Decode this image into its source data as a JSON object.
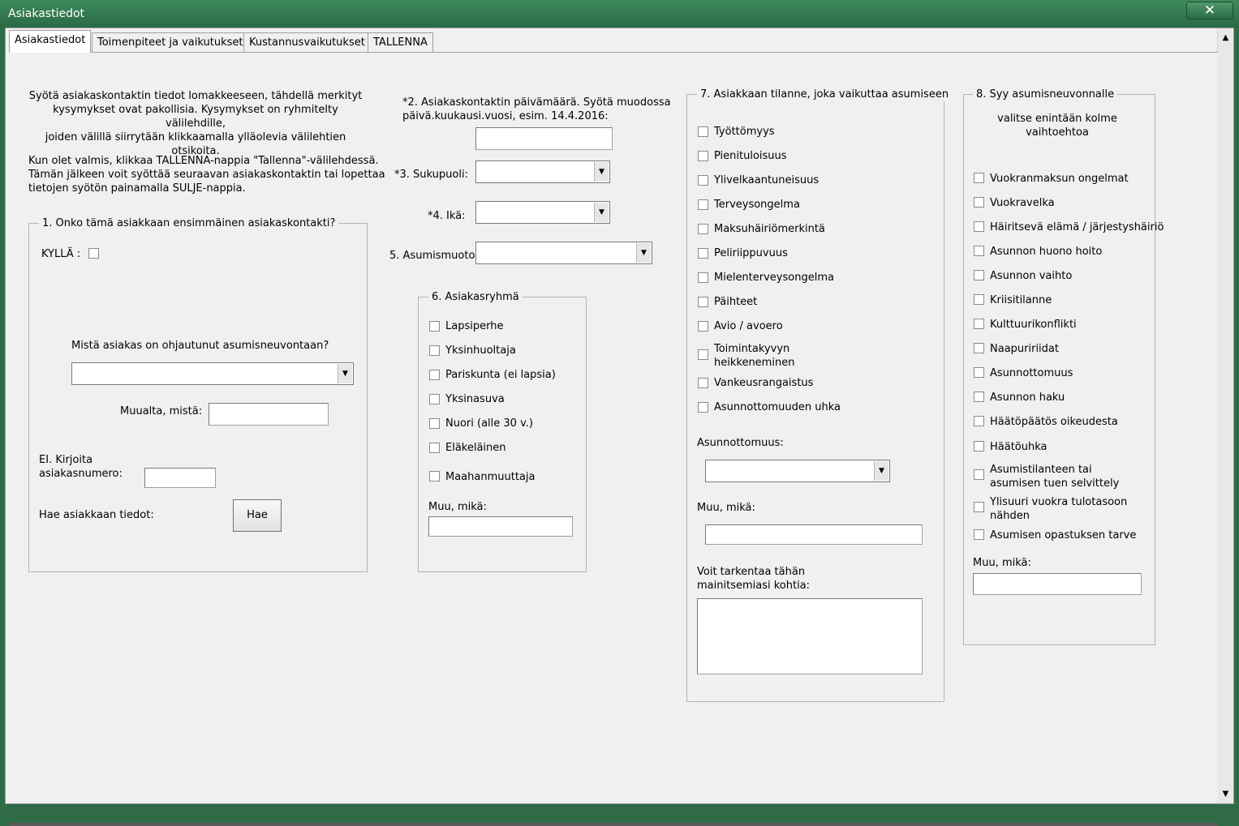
{
  "window": {
    "title": "Asiakastiedot",
    "close_label": "✕"
  },
  "tabs": [
    "Asiakastiedot",
    "Toimenpiteet ja vaikutukset",
    "Kustannusvaikutukset",
    "TALLENNA"
  ],
  "intro": {
    "line1": "Syötä asiakaskontaktin tiedot lomakkeeseen, tähdellä merkityt",
    "line2": "kysymykset ovat pakollisia. Kysymykset on ryhmitelty välilehdille,",
    "line3": "joiden välillä siirrytään klikkaamalla ylläolevia välilehtien otsikoita.",
    "line4": "Kun olet valmis, klikkaa TALLENNA-nappia \"Tallenna\"-välilehdessä.",
    "line5": "Tämän jälkeen voit syöttää seuraavan asiakaskontaktin tai lopettaa",
    "line6": "tietojen syötön painamalla SULJE-nappia."
  },
  "q1": {
    "legend": "1. Onko tämä asiakkaan ensimmäinen asiakaskontakti?",
    "yes_label": "KYLLÄ :",
    "referral_label": "Mistä asiakas on ohjautunut asumisneuvontaan?",
    "other_label": "Muualta, mistä:",
    "no_label_line1": "EI. Kirjoita",
    "no_label_line2": "asiakasnumero:",
    "fetch_label": "Hae asiakkaan tiedot:",
    "fetch_button": "Hae"
  },
  "q2": {
    "line1": "*2. Asiakaskontaktin päivämäärä. Syötä muodossa",
    "line2": "päivä.kuukausi.vuosi, esim. 14.4.2016:"
  },
  "q3": {
    "label": "*3. Sukupuoli:"
  },
  "q4": {
    "label": "*4. Ikä:"
  },
  "q5": {
    "label": "5. Asumismuoto:"
  },
  "q6": {
    "legend": "6. Asiakasryhmä",
    "options": [
      "Lapsiperhe",
      "Yksinhuoltaja",
      "Pariskunta (ei lapsia)",
      "Yksinasuva",
      "Nuori (alle 30 v.)",
      "Eläkeläinen",
      "Maahanmuuttaja"
    ],
    "other_label": "Muu, mikä:"
  },
  "q7": {
    "legend": "7. Asiakkaan tilanne, joka vaikuttaa asumiseen",
    "options": [
      "Työttömyys",
      "Pienituloisuus",
      "Ylivelkaantuneisuus",
      "Terveysongelma",
      "Maksuhäiriömerkintä",
      "Peliriippuvuus",
      "Mielenterveysongelma",
      "Päihteet",
      "Avio / avoero",
      "Toimintakyvyn",
      "heikkeneminen",
      "Vankeusrangaistus",
      "Asunnottomuuden uhka"
    ],
    "homeless_label": "Asunnottomuus:",
    "other_label": "Muu, mikä:",
    "specify_line1": "Voit tarkentaa tähän",
    "specify_line2": "mainitsemiasi kohtia:"
  },
  "q8": {
    "legend": "8. Syy asumisneuvonnalle",
    "hint_line1": "valitse enintään kolme",
    "hint_line2": "vaihtoehtoa",
    "options": [
      "Vuokranmaksun ongelmat",
      "Vuokravelka",
      "Häiritsevä elämä / järjestyshäiriö",
      "Asunnon huono hoito",
      "Asunnon vaihto",
      "Kriisitilanne",
      "Kulttuurikonflikti",
      "Naapuririidat",
      "Asunnottomuus",
      "Asunnon haku",
      "Häätöpäätös oikeudesta",
      "Häätöuhka",
      "Asumistilanteen tai",
      "asumisen tuen selvittely",
      "Ylisuuri vuokra tulotasoon",
      "nähden",
      "Asumisen opastuksen tarve"
    ],
    "other_label": "Muu, mikä:"
  }
}
